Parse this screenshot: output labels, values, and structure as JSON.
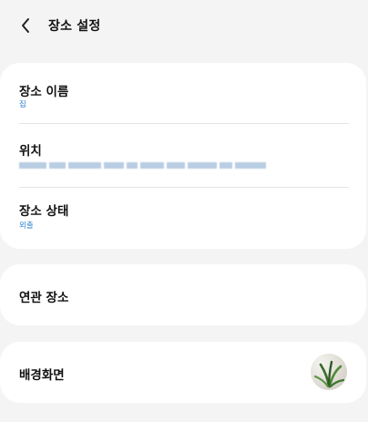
{
  "header": {
    "title": "장소 설정",
    "back_icon": "chevron-left-icon"
  },
  "place_card": {
    "name_label": "장소 이름",
    "name_value": "집",
    "location_label": "위치",
    "status_label": "장소 상태",
    "status_value": "외출"
  },
  "related": {
    "label": "연관 장소"
  },
  "background": {
    "label": "배경화면",
    "thumbnail_icon": "plant-wallpaper-thumbnail"
  },
  "colors": {
    "accent": "#2f7fd0",
    "page_bg": "#f4f4f4",
    "card_bg": "#ffffff"
  }
}
